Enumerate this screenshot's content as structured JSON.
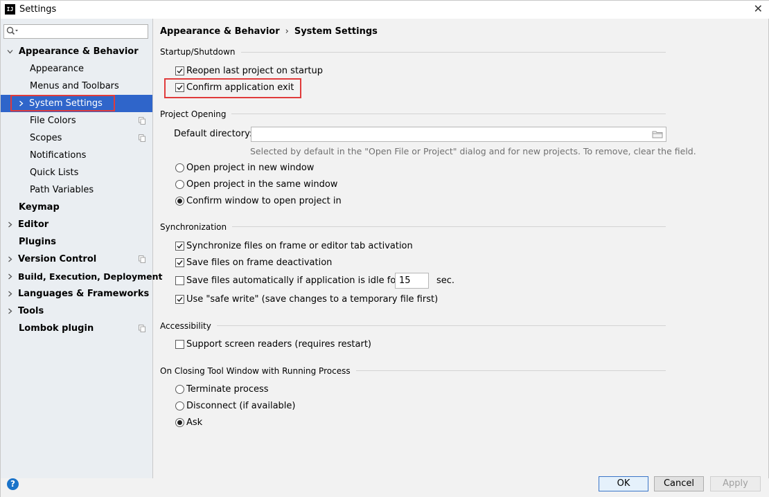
{
  "window": {
    "title": "Settings",
    "app_icon_text": "IJ"
  },
  "sidebar": {
    "search_placeholder": "",
    "items": [
      {
        "label": "Appearance & Behavior"
      },
      {
        "label": "Appearance"
      },
      {
        "label": "Menus and Toolbars"
      },
      {
        "label": "System Settings"
      },
      {
        "label": "File Colors"
      },
      {
        "label": "Scopes"
      },
      {
        "label": "Notifications"
      },
      {
        "label": "Quick Lists"
      },
      {
        "label": "Path Variables"
      },
      {
        "label": "Keymap"
      },
      {
        "label": "Editor"
      },
      {
        "label": "Plugins"
      },
      {
        "label": "Version Control"
      },
      {
        "label": "Build, Execution, Deployment"
      },
      {
        "label": "Languages & Frameworks"
      },
      {
        "label": "Tools"
      },
      {
        "label": "Lombok plugin"
      }
    ]
  },
  "breadcrumb": {
    "parent": "Appearance & Behavior",
    "separator": "›",
    "current": "System Settings"
  },
  "startup": {
    "title": "Startup/Shutdown",
    "reopen_label": "Reopen last project on startup",
    "reopen_checked": true,
    "confirm_exit_label": "Confirm application exit",
    "confirm_exit_checked": true
  },
  "project_opening": {
    "title": "Project Opening",
    "default_dir_label": "Default directory:",
    "default_dir_value": "",
    "hint": "Selected by default in the \"Open File or Project\" dialog and for new projects. To remove, clear the field.",
    "options": [
      {
        "label": "Open project in new window",
        "selected": false
      },
      {
        "label": "Open project in the same window",
        "selected": false
      },
      {
        "label": "Confirm window to open project in",
        "selected": true
      }
    ]
  },
  "sync": {
    "title": "Synchronization",
    "sync_files_label": "Synchronize files on frame or editor tab activation",
    "sync_files_checked": true,
    "save_deactivation_label": "Save files on frame deactivation",
    "save_deactivation_checked": true,
    "save_idle_label": "Save files automatically if application is idle for",
    "save_idle_checked": false,
    "idle_seconds": "15",
    "sec_label": "sec.",
    "safe_write_label": "Use \"safe write\" (save changes to a temporary file first)",
    "safe_write_checked": true
  },
  "accessibility": {
    "title": "Accessibility",
    "screen_readers_label": "Support screen readers (requires restart)",
    "screen_readers_checked": false
  },
  "closing": {
    "title": "On Closing Tool Window with Running Process",
    "options": [
      {
        "label": "Terminate process",
        "selected": false
      },
      {
        "label": "Disconnect (if available)",
        "selected": false
      },
      {
        "label": "Ask",
        "selected": true
      }
    ]
  },
  "buttons": {
    "help": "?",
    "ok": "OK",
    "cancel": "Cancel",
    "apply": "Apply"
  },
  "colors": {
    "selection": "#2f65ca",
    "highlight": "#e03b3b",
    "sidebar_bg": "#eaeef2"
  }
}
